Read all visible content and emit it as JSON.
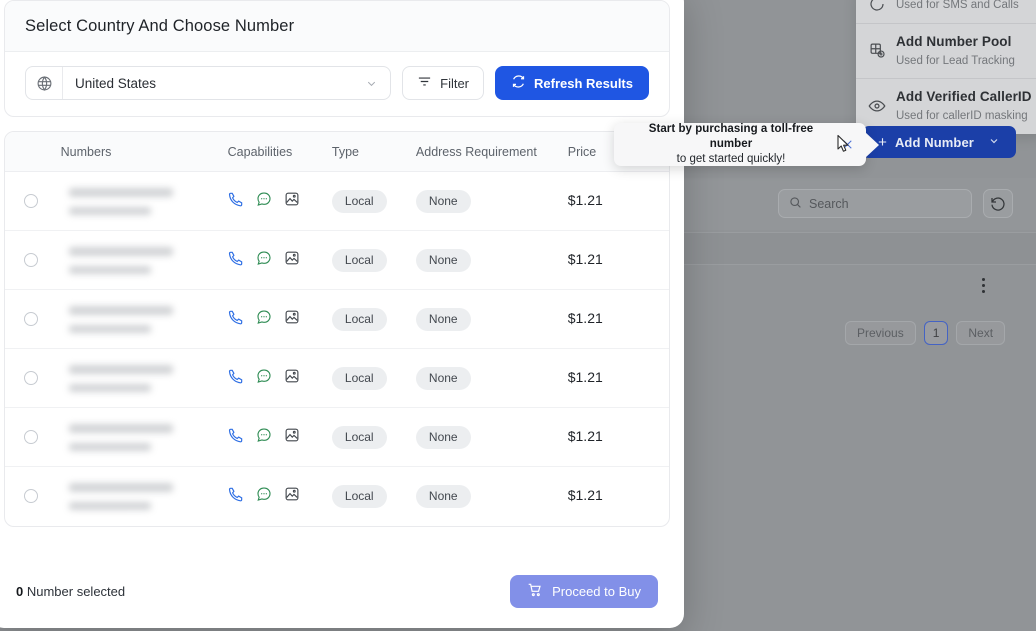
{
  "background": {
    "dropdown": {
      "items": [
        {
          "icon": "message-icon",
          "title": "",
          "subtitle": "Used for SMS and Calls"
        },
        {
          "icon": "number-pool-icon",
          "title": "Add Number Pool",
          "subtitle": "Used for Lead Tracking"
        },
        {
          "icon": "eye-icon",
          "title": "Add Verified CallerID",
          "subtitle": "Used for callerID masking"
        }
      ]
    },
    "add_number_button": {
      "label": "Add Number",
      "plus": "+",
      "chevron": "chevron-down-icon"
    },
    "search": {
      "placeholder": "Search",
      "icon": "search-icon"
    },
    "refresh_button": {
      "icon": "reset-icon"
    },
    "row_menu": {
      "icon": "kebab-menu-icon"
    },
    "pagination": {
      "previous": "Previous",
      "current": "1",
      "next": "Next"
    }
  },
  "modal": {
    "title": "Select Country And Choose Number",
    "country": {
      "value": "United States",
      "icon": "globe-icon",
      "chevron": "chevron-down-icon"
    },
    "filter_button": {
      "label": "Filter",
      "icon": "filter-icon"
    },
    "refresh_button": {
      "label": "Refresh Results",
      "icon": "refresh-icon"
    },
    "table": {
      "columns": [
        "",
        "Numbers",
        "Capabilities",
        "Type",
        "Address Requirement",
        "Price"
      ],
      "rows": [
        {
          "number": "",
          "location": "",
          "capabilities": [
            "voice",
            "sms",
            "mms"
          ],
          "type": "Local",
          "address": "None",
          "price": "$1.21"
        },
        {
          "number": "",
          "location": "",
          "capabilities": [
            "voice",
            "sms",
            "mms"
          ],
          "type": "Local",
          "address": "None",
          "price": "$1.21"
        },
        {
          "number": "",
          "location": "",
          "capabilities": [
            "voice",
            "sms",
            "mms"
          ],
          "type": "Local",
          "address": "None",
          "price": "$1.21"
        },
        {
          "number": "",
          "location": "",
          "capabilities": [
            "voice",
            "sms",
            "mms"
          ],
          "type": "Local",
          "address": "None",
          "price": "$1.21"
        },
        {
          "number": "",
          "location": "",
          "capabilities": [
            "voice",
            "sms",
            "mms"
          ],
          "type": "Local",
          "address": "None",
          "price": "$1.21"
        },
        {
          "number": "",
          "location": "",
          "capabilities": [
            "voice",
            "sms",
            "mms"
          ],
          "type": "Local",
          "address": "None",
          "price": "$1.21"
        }
      ]
    },
    "footer": {
      "selected_count": "0",
      "selected_label": " Number selected",
      "buy_button": {
        "label": "Proceed to Buy",
        "icon": "cart-icon"
      }
    }
  },
  "tooltip": {
    "line1": "Start by purchasing a toll-free number",
    "line2": "to get started quickly!",
    "close": "close-icon"
  },
  "colors": {
    "primary_blue": "#1f56e3",
    "buy_purple": "#8290e8",
    "voice_icon": "#2f6fe4",
    "sms_icon": "#2f8c54",
    "overlay": "#919497"
  }
}
